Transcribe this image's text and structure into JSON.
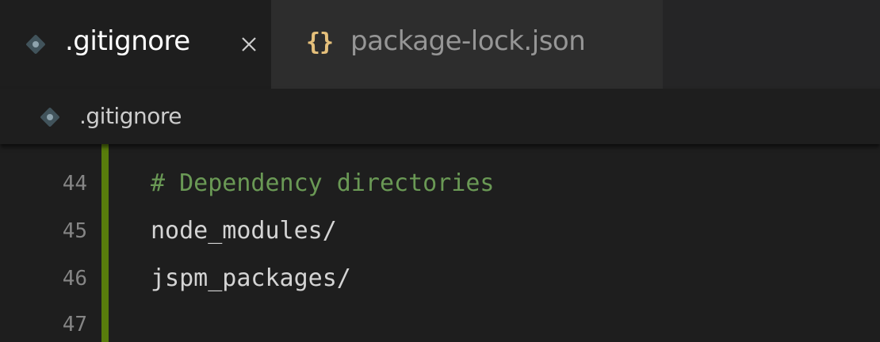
{
  "tabs": [
    {
      "label": ".gitignore",
      "icon": "git-file-icon",
      "active": true
    },
    {
      "label": "package-lock.json",
      "icon": "json-braces-icon",
      "active": false
    }
  ],
  "breadcrumb": {
    "label": ".gitignore"
  },
  "editor": {
    "lines": [
      {
        "number": "44",
        "text": "# Dependency directories",
        "kind": "comment"
      },
      {
        "number": "45",
        "text": "node_modules/",
        "kind": "text"
      },
      {
        "number": "46",
        "text": "jspm_packages/",
        "kind": "text"
      },
      {
        "number": "47",
        "text": "",
        "kind": "text"
      }
    ]
  },
  "icons": {
    "json": "{}"
  },
  "colors": {
    "comment": "#6a9955",
    "gutter_modified": "#587c0c",
    "json_icon": "#e5c07b"
  }
}
